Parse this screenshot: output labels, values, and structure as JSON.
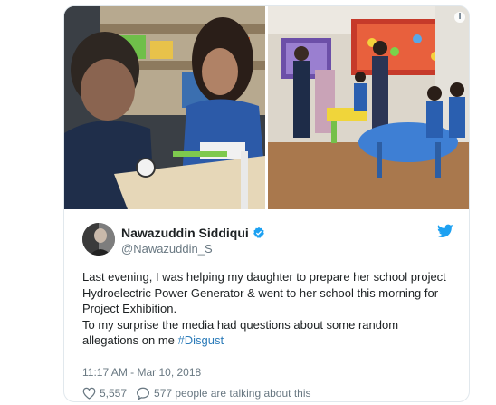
{
  "tweet": {
    "author": {
      "name": "Nawazuddin Siddiqui",
      "handle": "@Nawazuddin_S"
    },
    "text_lines": [
      "Last evening, I was helping my daughter to prepare her school project Hydroelectric Power Generator & went to her school this morning for Project Exhibition.",
      "To my surprise the media had questions about some random allegations on me"
    ],
    "hashtag": "#Disgust",
    "timestamp": "11:17 AM - Mar 10, 2018",
    "likes": "5,557",
    "replies_text": "577 people are talking about this"
  },
  "colors": {
    "accent": "#1da1f2",
    "hashtag": "#2b7bb9",
    "muted": "#697882"
  },
  "icons": [
    "info-icon",
    "verified-badge-icon",
    "twitter-bird-icon",
    "heart-icon",
    "reply-icon"
  ]
}
